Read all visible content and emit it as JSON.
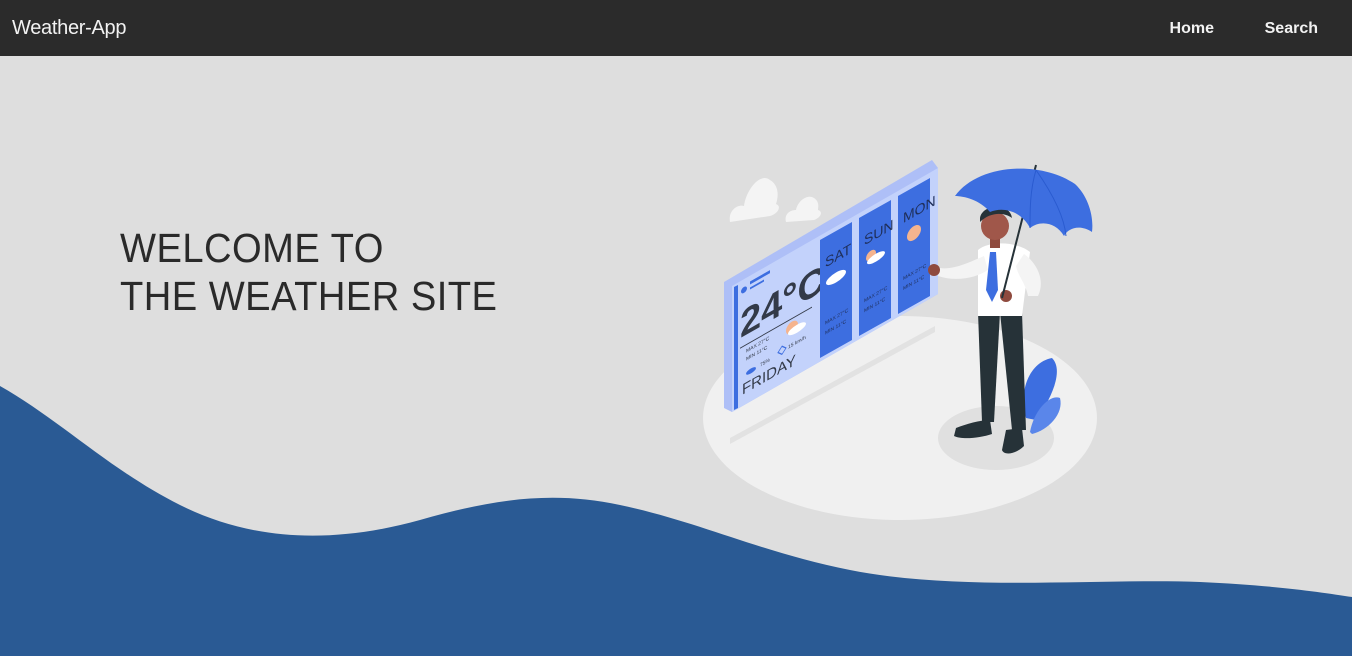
{
  "navbar": {
    "brand": "Weather-App",
    "links": [
      {
        "label": "Home"
      },
      {
        "label": "Search"
      }
    ]
  },
  "hero": {
    "title_line1": "WELCOME TO",
    "title_line2": "THE WEATHER SITE"
  },
  "illustration": {
    "main_temp": "24°C",
    "main_day": "FRIDAY",
    "main_max": "MAX  27°C",
    "main_min": "MIN   11°C",
    "main_humidity": "75%",
    "main_wind": "15 km/h",
    "forecast": [
      {
        "day": "SAT",
        "max": "MAX 27°C",
        "min": "MIN 11°C"
      },
      {
        "day": "SUN",
        "max": "MAX 27°C",
        "min": "MIN 11°C"
      },
      {
        "day": "MON",
        "max": "MAX 27°C",
        "min": "MIN 11°C"
      }
    ]
  },
  "colors": {
    "navbar_bg": "#2b2b2b",
    "page_bg": "#dedede",
    "wave": "#2a5a94",
    "accent_blue": "#3d6ee0",
    "panel_light": "#c3d2fb"
  }
}
